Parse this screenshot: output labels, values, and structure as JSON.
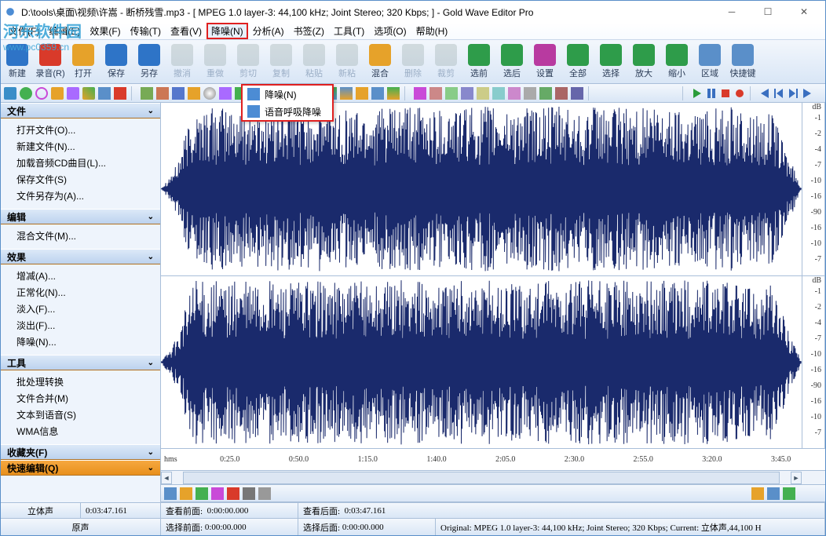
{
  "titlebar": {
    "title": "D:\\tools\\桌面\\视频\\许嵩 - 断桥残雪.mp3 - [ MPEG 1.0 layer-3: 44,100 kHz; Joint Stereo; 320 Kbps; ] - Gold Wave Editor Pro"
  },
  "watermark": {
    "line1": "河东软件园",
    "line2": "www.pc0359.cn"
  },
  "menu": {
    "items": [
      "文件(F)",
      "编辑(E)",
      "效果(F)",
      "传输(T)",
      "查看(V)",
      "降噪(N)",
      "分析(A)",
      "书签(Z)",
      "工具(T)",
      "选项(O)",
      "帮助(H)"
    ],
    "open_index": 5
  },
  "dropdown": {
    "items": [
      "降噪(N)",
      "语音呼吸降噪"
    ]
  },
  "toolbar_main": [
    {
      "label": "新建",
      "color": "#2e74c7",
      "enabled": true,
      "name": "new"
    },
    {
      "label": "录音(R)",
      "color": "#d93a2a",
      "enabled": true,
      "name": "record"
    },
    {
      "label": "打开",
      "color": "#e6a22a",
      "enabled": true,
      "name": "open"
    },
    {
      "label": "保存",
      "color": "#2e74c7",
      "enabled": true,
      "name": "save"
    },
    {
      "label": "另存",
      "color": "#2e74c7",
      "enabled": true,
      "name": "saveas"
    },
    {
      "label": "撤消",
      "color": "#9aa",
      "enabled": false,
      "name": "undo"
    },
    {
      "label": "重做",
      "color": "#9aa",
      "enabled": false,
      "name": "redo"
    },
    {
      "label": "剪切",
      "color": "#9aa",
      "enabled": false,
      "name": "cut"
    },
    {
      "label": "复制",
      "color": "#9aa",
      "enabled": false,
      "name": "copy"
    },
    {
      "label": "粘贴",
      "color": "#9aa",
      "enabled": false,
      "name": "paste"
    },
    {
      "label": "新粘",
      "color": "#9aa",
      "enabled": false,
      "name": "paste-new"
    },
    {
      "label": "混合",
      "color": "#e6a22a",
      "enabled": true,
      "name": "mix"
    },
    {
      "label": "删除",
      "color": "#9aa",
      "enabled": false,
      "name": "delete"
    },
    {
      "label": "裁剪",
      "color": "#9aa",
      "enabled": false,
      "name": "crop"
    },
    {
      "label": "选前",
      "color": "#2e9c4a",
      "enabled": true,
      "name": "sel-before"
    },
    {
      "label": "选后",
      "color": "#2e9c4a",
      "enabled": true,
      "name": "sel-after"
    },
    {
      "label": "设置",
      "color": "#b83aa0",
      "enabled": true,
      "name": "settings"
    },
    {
      "label": "全部",
      "color": "#2e9c4a",
      "enabled": true,
      "name": "all"
    },
    {
      "label": "选择",
      "color": "#2e9c4a",
      "enabled": true,
      "name": "select"
    },
    {
      "label": "放大",
      "color": "#2e9c4a",
      "enabled": true,
      "name": "zoom-in"
    },
    {
      "label": "缩小",
      "color": "#2e9c4a",
      "enabled": true,
      "name": "zoom-out"
    },
    {
      "label": "区域",
      "color": "#5a8fc9",
      "enabled": true,
      "name": "region"
    },
    {
      "label": "快捷键",
      "color": "#5a8fc9",
      "enabled": true,
      "name": "shortcuts"
    }
  ],
  "sidebar": {
    "sections": [
      {
        "title": "文件",
        "items": [
          "打开文件(O)...",
          "新建文件(N)...",
          "加载音频CD曲目(L)...",
          "保存文件(S)",
          "文件另存为(A)..."
        ]
      },
      {
        "title": "编辑",
        "items": [
          "混合文件(M)..."
        ]
      },
      {
        "title": "效果",
        "items": [
          "增减(A)...",
          "正常化(N)...",
          "淡入(F)...",
          "淡出(F)...",
          "降噪(N)..."
        ]
      },
      {
        "title": "工具",
        "items": [
          "批处理转换",
          "文件合并(M)",
          "文本到语音(S)",
          "WMA信息"
        ]
      }
    ],
    "footers": [
      {
        "title": "收藏夹(F)"
      },
      {
        "title": "快速编辑(Q)"
      }
    ]
  },
  "db_scale": {
    "unit": "dB",
    "labels": [
      "-1",
      "-2",
      "-4",
      "-7",
      "-10",
      "-16",
      "-90",
      "-16",
      "-10",
      "-7"
    ]
  },
  "timeline": {
    "unit": "hms",
    "marks": [
      "0:25.0",
      "0:50.0",
      "1:15.0",
      "1:40.0",
      "2:05.0",
      "2:30.0",
      "2:55.0",
      "3:20.0",
      "3:45.0"
    ]
  },
  "status1": {
    "channels": "立体声",
    "duration": "0:03:47.161",
    "beforeLabel": "查看前面:",
    "before": "0:00:00.000",
    "afterLabel": "查看后面:",
    "after": "0:03:47.161"
  },
  "status2": {
    "track": "原声",
    "selBeforeLabel": "选择前面:",
    "selBefore": "0:00:00.000",
    "selAfterLabel": "选择后面:",
    "selAfter": "0:00:00.000",
    "info": "Original: MPEG 1.0 layer-3: 44,100 kHz; Joint Stereo; 320 Kbps;  Current: 立体声,44,100 H"
  }
}
